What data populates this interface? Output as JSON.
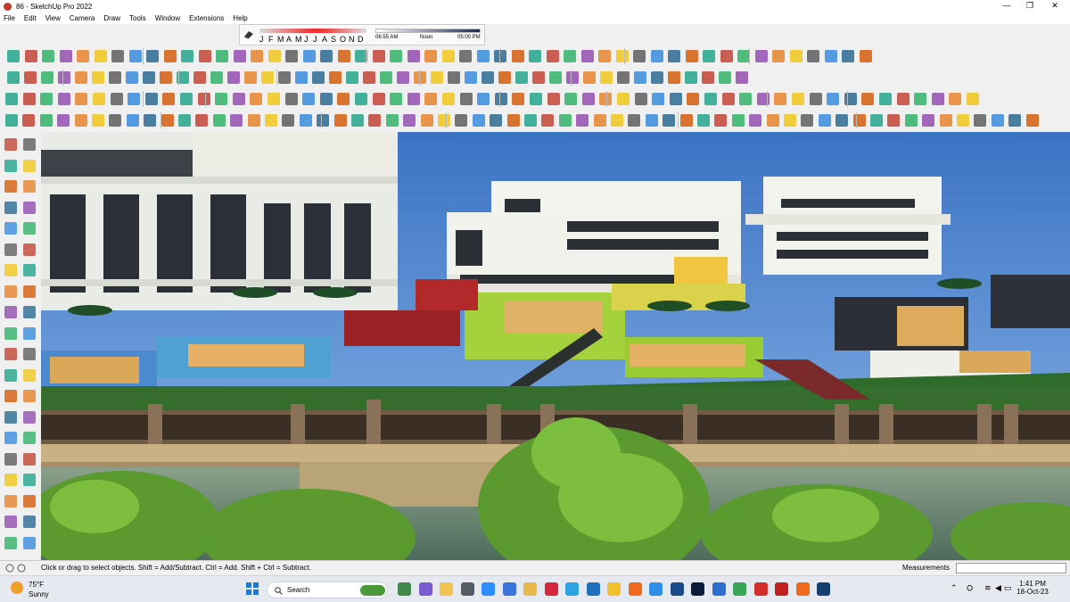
{
  "window": {
    "title": "86 - SketchUp Pro 2022",
    "minimize": "—",
    "maximize": "❐",
    "close": "✕"
  },
  "menu": [
    "File",
    "Edit",
    "View",
    "Camera",
    "Draw",
    "Tools",
    "Window",
    "Extensions",
    "Help"
  ],
  "shadows": {
    "months": [
      "J",
      "F",
      "M",
      "A",
      "M",
      "J",
      "J",
      "A",
      "S",
      "O",
      "N",
      "D"
    ],
    "time_start": "06:55 AM",
    "time_mid": "Noon",
    "time_end": "05:00 PM"
  },
  "status": {
    "message": "Click or drag to select objects. Shift = Add/Subtract. Ctrl = Add. Shift + Ctrl = Subtract.",
    "measurements_label": "Measurements",
    "measurements_value": ""
  },
  "taskbar": {
    "temperature": "75°F",
    "condition": "Sunny",
    "search_label": "Search",
    "time": "1:41 PM",
    "date": "18-Oct-23",
    "apps": [
      {
        "name": "search-app-icon",
        "color": "#3f8a4a"
      },
      {
        "name": "copilot-icon",
        "color": "#7a5cd0"
      },
      {
        "name": "file-explorer-icon",
        "color": "#f2c14e"
      },
      {
        "name": "task-view-icon",
        "color": "#555b66"
      },
      {
        "name": "zoom-icon",
        "color": "#2d8cff"
      },
      {
        "name": "calendar-app-icon",
        "color": "#3a73d9"
      },
      {
        "name": "folder-icon",
        "color": "#e8b84a"
      },
      {
        "name": "opera-icon",
        "color": "#d6263b"
      },
      {
        "name": "telegram-icon",
        "color": "#2aa3e0"
      },
      {
        "name": "store-icon",
        "color": "#1f6fbd"
      },
      {
        "name": "notes-icon",
        "color": "#f0c02e"
      },
      {
        "name": "brave-icon",
        "color": "#ef6b1b"
      },
      {
        "name": "messages-icon",
        "color": "#2f8fe6"
      },
      {
        "name": "sketchup-icon",
        "color": "#1c4b8a"
      },
      {
        "name": "photoshop-icon",
        "color": "#0a1c3a"
      },
      {
        "name": "mail-icon",
        "color": "#2d6fd0"
      },
      {
        "name": "chrome-icon",
        "color": "#3aa655"
      },
      {
        "name": "pinterest-icon",
        "color": "#d42b2b"
      },
      {
        "name": "pinterest-alt-icon",
        "color": "#c32020"
      },
      {
        "name": "soundcloud-icon",
        "color": "#f06a1d"
      },
      {
        "name": "sketchup-layout-icon",
        "color": "#163e70"
      }
    ]
  },
  "colors": {
    "sky": "#5b93d6",
    "grass": "#2f6b2a",
    "water": "#5f7f68",
    "wall": "#eef0ee",
    "accent_red": "#d82c2c"
  }
}
